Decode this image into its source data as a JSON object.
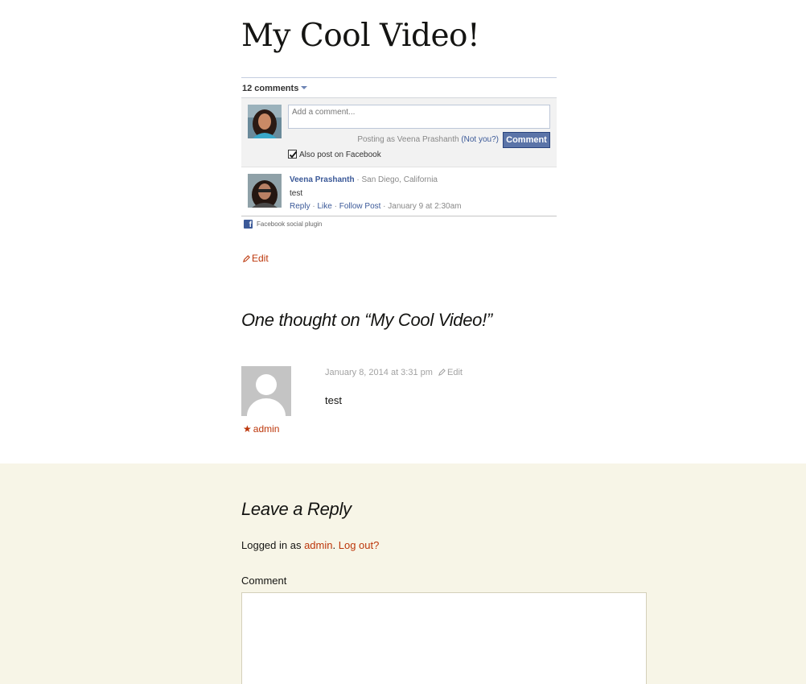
{
  "post": {
    "title": "My Cool Video!",
    "edit_label": "Edit"
  },
  "fb": {
    "comment_count": "12 comments",
    "input_placeholder": "Add a comment...",
    "posting_as": "Posting as Veena Prashanth",
    "not_you": "(Not you?)",
    "comment_button": "Comment",
    "also_post": "Also post on Facebook",
    "also_post_checked": true,
    "comments": [
      {
        "author": "Veena Prashanth",
        "location": "San Diego, California",
        "text": "test",
        "reply": "Reply",
        "like": "Like",
        "follow": "Follow Post",
        "date": "January 9 at 2:30am"
      }
    ],
    "social_plugin": "Facebook social plugin",
    "brand_color": "#3b5998"
  },
  "comments_section": {
    "title": "One thought on “My Cool Video!”",
    "items": [
      {
        "author": "admin",
        "date": "January 8, 2014 at 3:31 pm",
        "edit": "Edit",
        "body": "test"
      }
    ]
  },
  "reply": {
    "title": "Leave a Reply",
    "logged_in_prefix": "Logged in as",
    "user": "admin",
    "period": ".",
    "logout": "Log out?",
    "comment_label": "Comment",
    "background": "#f7f5e7",
    "link_color": "#bc360a"
  }
}
